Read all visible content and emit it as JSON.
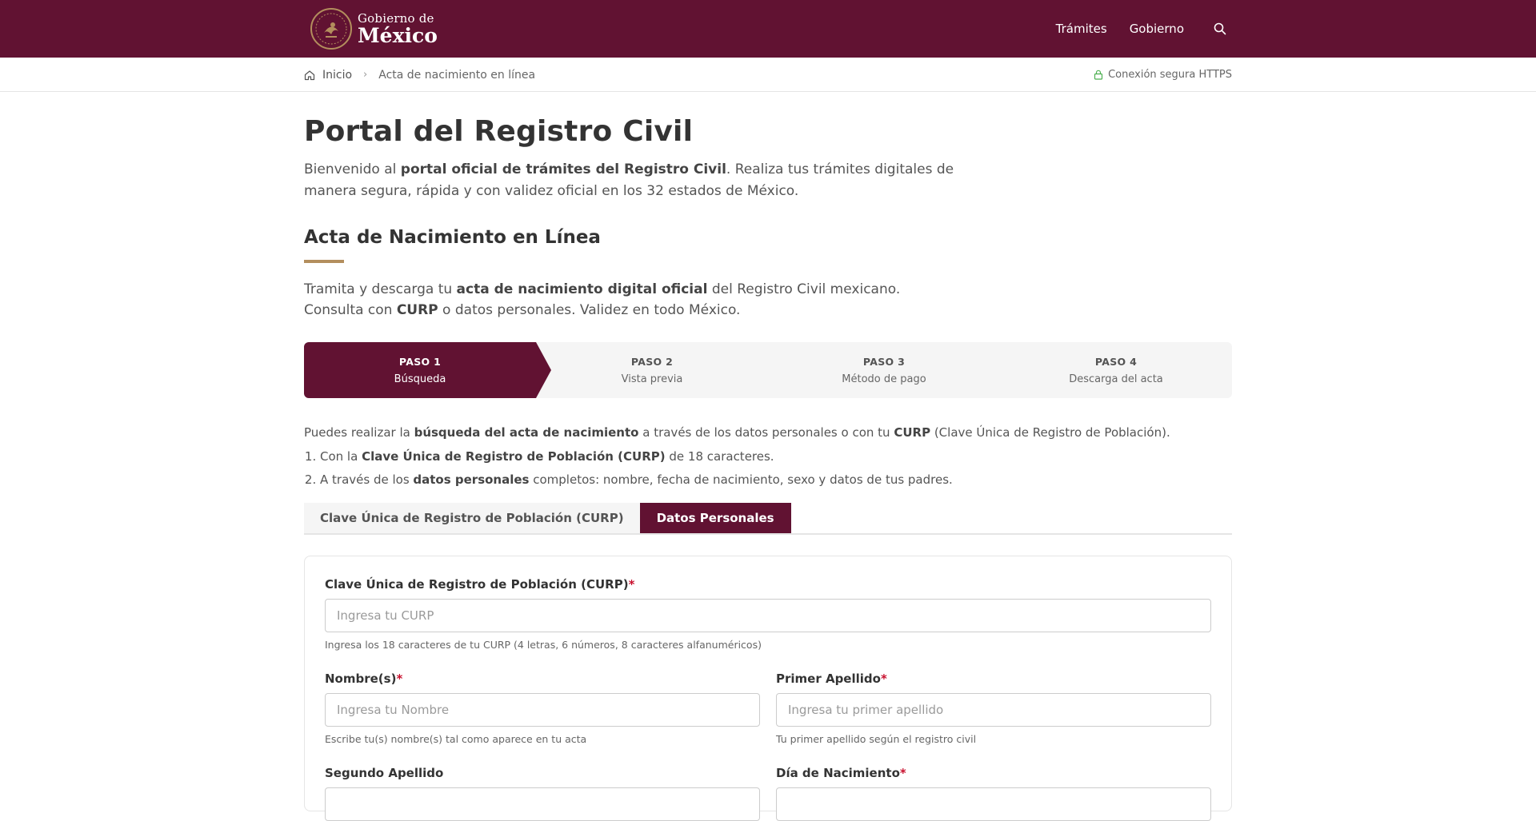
{
  "header": {
    "logo_line1": "Gobierno de",
    "logo_line2": "México",
    "nav": [
      "Trámites",
      "Gobierno"
    ],
    "search_icon": "search-icon"
  },
  "breadcrumb": {
    "home": "Inicio",
    "current": "Acta de nacimiento en línea",
    "secure": "Conexión segura HTTPS"
  },
  "page": {
    "title": "Portal del Registro Civil",
    "intro_pre": "Bienvenido al ",
    "intro_bold": "portal oficial de trámites del Registro Civil",
    "intro_post": ". Realiza tus trámites digitales de manera segura, rápida y con validez oficial en los 32 estados de México.",
    "section_title": "Acta de Nacimiento en Línea",
    "desc_pre": "Tramita y descarga tu ",
    "desc_bold1": "acta de nacimiento digital oficial",
    "desc_mid": " del Registro Civil mexicano. Consulta con ",
    "desc_bold2": "CURP",
    "desc_post": " o datos personales. Validez en todo México."
  },
  "steps": [
    {
      "num": "PASO 1",
      "label": "Búsqueda"
    },
    {
      "num": "PASO 2",
      "label": "Vista previa"
    },
    {
      "num": "PASO 3",
      "label": "Método de pago"
    },
    {
      "num": "PASO 4",
      "label": "Descarga del acta"
    }
  ],
  "instructions": {
    "p1": "Puedes realizar la ",
    "b1": "búsqueda del acta de nacimiento",
    "p2": " a través de los datos personales o con tu ",
    "b2": "CURP",
    "p3": " (Clave Única de Registro de Población).",
    "opt1_pre": "Con la ",
    "opt1_bold": "Clave Única de Registro de Población (CURP)",
    "opt1_post": " de 18 caracteres.",
    "opt2_pre": "A través de los ",
    "opt2_bold": "datos personales",
    "opt2_post": " completos: nombre, fecha de nacimiento, sexo y datos de tus padres."
  },
  "tabs": {
    "curp": "Clave Única de Registro de Población (CURP)",
    "personal": "Datos Personales"
  },
  "form": {
    "curp_label": "Clave Única de Registro de Población (CURP)",
    "curp_placeholder": "Ingresa tu CURP",
    "curp_help": "Ingresa los 18 caracteres de tu CURP (4 letras, 6 números, 8 caracteres alfanuméricos)",
    "nombre_label": "Nombre(s)",
    "nombre_placeholder": "Ingresa tu Nombre",
    "nombre_help": "Escribe tu(s) nombre(s) tal como aparece en tu acta",
    "apellido1_label": "Primer Apellido",
    "apellido1_placeholder": "Ingresa tu primer apellido",
    "apellido1_help": "Tu primer apellido según el registro civil",
    "apellido2_label": "Segundo Apellido",
    "dia_label": "Día de Nacimiento",
    "required_mark": "*"
  },
  "colors": {
    "brand": "#611232",
    "gold": "#b38e5d",
    "required": "#c8102e"
  }
}
